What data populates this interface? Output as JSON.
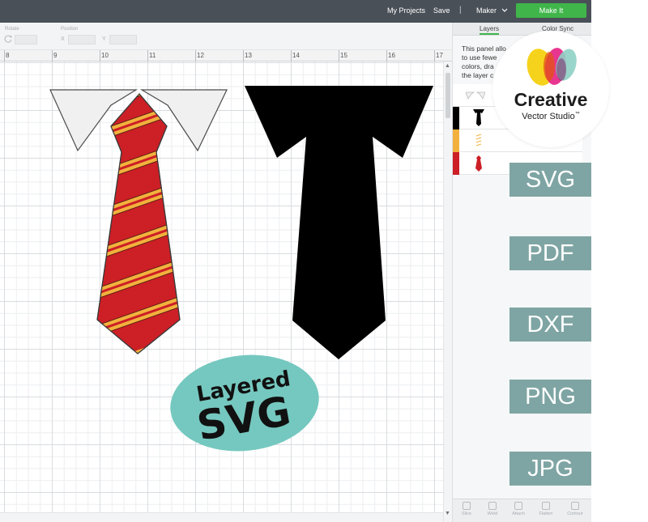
{
  "topbar": {
    "my_projects": "My Projects",
    "save": "Save",
    "separator": "|",
    "machine": "Maker",
    "make_it": "Make It"
  },
  "edit_toolbar": {
    "rotate_label": "Rotate",
    "position_label": "Position",
    "x_label": "X",
    "y_label": "Y"
  },
  "ruler": {
    "ticks": [
      "8",
      "9",
      "10",
      "11",
      "12",
      "13",
      "14",
      "15",
      "16",
      "17"
    ]
  },
  "panel": {
    "tabs": [
      "Layers",
      "Color Sync"
    ],
    "info_lines": [
      "This panel allo",
      "to use fewe",
      "colors, dra",
      "the layer c"
    ],
    "layers": [
      {
        "name": "collar",
        "color": "#ffffff"
      },
      {
        "name": "black-tie",
        "color": "#000000"
      },
      {
        "name": "yellow-stripes",
        "color": "#f2b13d"
      },
      {
        "name": "red-tie",
        "color": "#cc1f26"
      }
    ],
    "bottom_tools": [
      "Slice",
      "Weld",
      "Attach",
      "Flatten",
      "Contour"
    ]
  },
  "logo": {
    "brand": "Creative",
    "sub": "Vector Studio",
    "trademark": "™"
  },
  "formats": [
    "SVG",
    "PDF",
    "DXF",
    "PNG",
    "JPG"
  ],
  "sticker": {
    "line1": "Layered",
    "line2": "SVG"
  },
  "colors": {
    "topbar": "#4a5058",
    "make_it": "#3fb54a",
    "badge": "#7ea5a3",
    "sticker": "#75c8bf",
    "tie_red": "#cc1f26",
    "tie_stripe": "#f2b13d",
    "collar": "#f0f0f0",
    "tie_black": "#000000"
  }
}
